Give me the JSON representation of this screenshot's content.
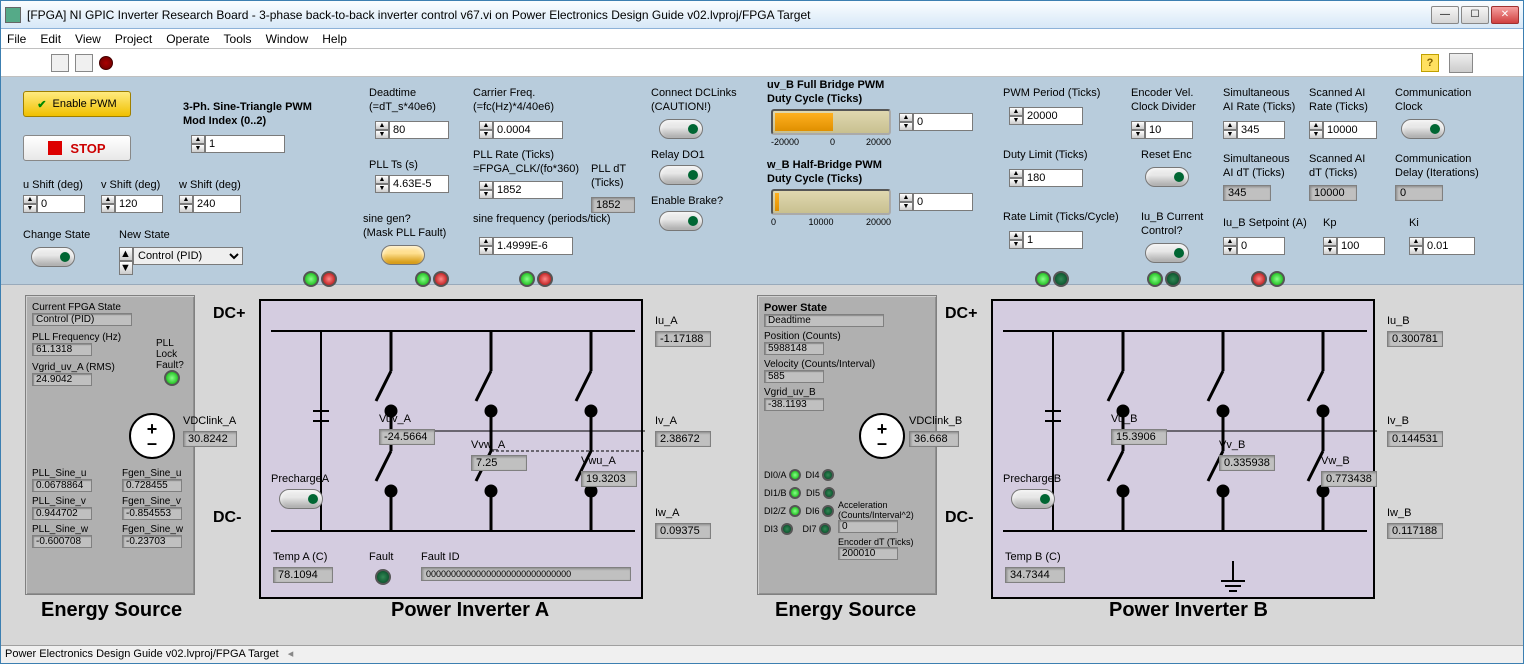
{
  "window": {
    "title": "[FPGA] NI GPIC Inverter Research Board - 3-phase back-to-back inverter control v67.vi on Power Electronics Design Guide v02.lvproj/FPGA Target"
  },
  "menu": {
    "file": "File",
    "edit": "Edit",
    "view": "View",
    "project": "Project",
    "operate": "Operate",
    "tools": "Tools",
    "window": "Window",
    "help": "Help"
  },
  "toolbar": {
    "help": "?"
  },
  "top": {
    "enable_pwm": "Enable PWM",
    "stop": "STOP",
    "u_shift_lbl": "u Shift (deg)",
    "u_shift": "0",
    "v_shift_lbl": "v Shift (deg)",
    "v_shift": "120",
    "w_shift_lbl": "w Shift (deg)",
    "w_shift": "240",
    "change_state_lbl": "Change State",
    "new_state_lbl": "New State",
    "new_state": "Control (PID)",
    "sine_tri_lbl": "3-Ph. Sine-Triangle PWM",
    "mod_index_lbl": "Mod Index (0..2)",
    "mod_index": "1",
    "deadtime_lbl": "Deadtime",
    "deadtime_sub": "(=dT_s*40e6)",
    "deadtime": "80",
    "pll_ts_lbl": "PLL Ts (s)",
    "pll_ts": "4.63E-5",
    "sine_gen_lbl": "sine gen?",
    "sine_gen_sub": "(Mask PLL Fault)",
    "carrier_lbl": "Carrier Freq.",
    "carrier_sub": "(=fc(Hz)*4/40e6)",
    "carrier": "0.0004",
    "pll_rate_lbl": "PLL Rate (Ticks)",
    "pll_rate_sub": "=FPGA_CLK/(fo*360)",
    "pll_rate": "1852",
    "sine_freq_lbl": "sine frequency (periods/tick)",
    "sine_freq": "1.4999E-6",
    "pll_dt_lbl": "PLL dT",
    "pll_dt_sub": "(Ticks)",
    "pll_dt": "1852",
    "connect_dc_lbl": "Connect DCLinks",
    "connect_dc_sub": "(CAUTION!)",
    "relay_lbl": "Relay DO1",
    "brake_lbl": "Enable Brake?",
    "uv_b_lbl": "uv_B Full Bridge PWM",
    "uv_b_sub": "Duty Cycle (Ticks)",
    "uv_b_val": "0",
    "uv_b_ticks": {
      "a": "-20000",
      "b": "0",
      "c": "20000"
    },
    "w_b_lbl": "w_B Half-Bridge PWM",
    "w_b_sub": "Duty Cycle (Ticks)",
    "w_b_val": "0",
    "w_b_ticks": {
      "a": "0",
      "b": "10000",
      "c": "20000"
    },
    "pwm_period_lbl": "PWM Period (Ticks)",
    "pwm_period": "20000",
    "duty_limit_lbl": "Duty Limit (Ticks)",
    "duty_limit": "180",
    "rate_limit_lbl": "Rate Limit (Ticks/Cycle)",
    "rate_limit": "1",
    "enc_div_lbl": "Encoder Vel.",
    "enc_div_sub": "Clock Divider",
    "enc_div": "10",
    "reset_enc_lbl": "Reset Enc",
    "iu_b_cc_lbl": "Iu_B Current",
    "iu_b_cc_sub": "Control?",
    "sim_ai_rate_lbl": "Simultaneous",
    "sim_ai_rate_sub": "AI Rate (Ticks)",
    "sim_ai_rate": "345",
    "sim_ai_dt_lbl": "Simultaneous",
    "sim_ai_dt_sub": "AI dT (Ticks)",
    "sim_ai_dt": "345",
    "iu_b_sp_lbl": "Iu_B Setpoint (A)",
    "iu_b_sp": "0",
    "scan_rate_lbl": "Scanned AI",
    "scan_rate_sub": "Rate (Ticks)",
    "scan_rate": "10000",
    "scan_dt_lbl": "Scanned AI",
    "scan_dt_sub": "dT (Ticks)",
    "scan_dt": "10000",
    "kp_lbl": "Kp",
    "kp": "100",
    "comm_clk_lbl": "Communication",
    "comm_clk_sub": "Clock",
    "comm_delay_lbl": "Communication",
    "comm_delay_sub": "Delay (Iterations)",
    "comm_delay": "0",
    "ki_lbl": "Ki",
    "ki": "0.01"
  },
  "diag": {
    "dc_plus": "DC+",
    "dc_minus": "DC-",
    "es_a": {
      "title": "Energy Source",
      "title_b": "Energy Source",
      "state_lbl": "Current FPGA State",
      "state": "Control (PID)",
      "pll_freq_lbl": "PLL Frequency (Hz)",
      "pll_freq": "61.1318",
      "vgrid_lbl": "Vgrid_uv_A (RMS)",
      "vgrid": "24.9042",
      "pll_lock_lbl": "PLL Lock",
      "fault_lbl": "Fault?",
      "vdc_lbl": "VDClink_A",
      "vdc": "30.8242",
      "precharge_lbl": "PrechargeA",
      "pll_sin_u_lbl": "PLL_Sine_u",
      "pll_sin_u": "0.0678864",
      "pll_sin_v_lbl": "PLL_Sine_v",
      "pll_sin_v": "0.944702",
      "pll_sin_w_lbl": "PLL_Sine_w",
      "pll_sin_w": "-0.600708",
      "fgen_u_lbl": "Fgen_Sine_u",
      "fgen_u": "0.728455",
      "fgen_v_lbl": "Fgen_Sine_v",
      "fgen_v": "-0.854553",
      "fgen_w_lbl": "Fgen_Sine_w",
      "fgen_w": "-0.23703"
    },
    "inv_a": {
      "title": "Power Inverter A",
      "temp_lbl": "Temp A (C)",
      "temp": "78.1094",
      "fault_lbl": "Fault",
      "fault_id_lbl": "Fault ID",
      "fault_id": "00000000000000000000000000000",
      "vuv_lbl": "Vuv_A",
      "vuv": "-24.5664",
      "vvw_lbl": "Vvw_A",
      "vvw": "7.25",
      "vwu_lbl": "Vwu_A",
      "vwu": "19.3203",
      "iu_lbl": "Iu_A",
      "iu": "-1.17188",
      "iv_lbl": "Iv_A",
      "iv": "2.38672",
      "iw_lbl": "Iw_A",
      "iw": "0.09375"
    },
    "es_b": {
      "ps_lbl": "Power State",
      "ps": "Deadtime",
      "pos_lbl": "Position (Counts)",
      "pos": "5988148",
      "vel_lbl": "Velocity (Counts/Interval)",
      "vel": "585",
      "vgrid_lbl": "Vgrid_uv_B",
      "vgrid": "-38.1193",
      "vdc_lbl": "VDClink_B",
      "vdc": "36.668",
      "precharge_lbl": "PrechargeB",
      "di0": "DI0/A",
      "di1": "DI1/B",
      "di2": "DI2/Z",
      "di3": "DI3",
      "di4": "DI4",
      "di5": "DI5",
      "di6": "DI6",
      "di7": "DI7",
      "acc_lbl": "Acceleration (Counts/Interval^2)",
      "acc": "0",
      "enc_dt_lbl": "Encoder dT (Ticks)",
      "enc_dt": "200010"
    },
    "inv_b": {
      "title": "Power Inverter B",
      "temp_lbl": "Temp B (C)",
      "temp": "34.7344",
      "vu_lbl": "Vu_B",
      "vu": "15.3906",
      "vv_lbl": "Vv_B",
      "vv": "0.335938",
      "vw_lbl": "Vw_B",
      "vw": "0.773438",
      "iu_lbl": "Iu_B",
      "iu": "0.300781",
      "iv_lbl": "Iv_B",
      "iv": "0.144531",
      "iw_lbl": "Iw_B",
      "iw": "0.117188"
    }
  },
  "status": "Power Electronics Design Guide v02.lvproj/FPGA Target"
}
